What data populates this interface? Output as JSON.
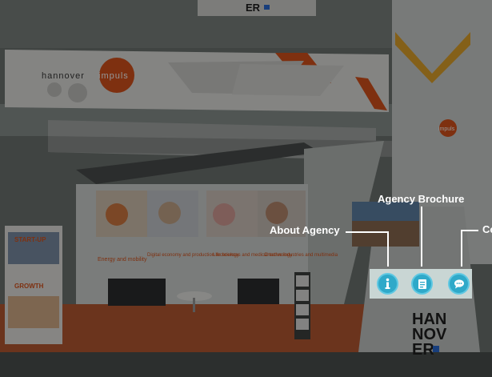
{
  "scene": {
    "top_sign": "ER",
    "banner_left_text_1": "hannover",
    "banner_left_text_2": "impuls",
    "column_text": "impuls",
    "poster_labels": [
      "Energy and mobility",
      "Digital economy and production technology",
      "Life sciences and medical technology",
      "Creative industries and multimedia"
    ],
    "rollup_text_1": "START-UP",
    "rollup_text_2": "GROWTH",
    "kiosk_logo_1": "HAN",
    "kiosk_logo_2": "NOV",
    "kiosk_logo_3": "ER"
  },
  "hotspots": {
    "about": {
      "label": "About Agency",
      "icon": "info-icon"
    },
    "brochure": {
      "label": "Agency Brochure",
      "icon": "document-icon"
    },
    "contact": {
      "label": "Co",
      "icon": "chat-icon"
    }
  },
  "colors": {
    "hotspot_fill": "#2fa9c9",
    "accent_orange": "#d9541c",
    "callout_text": "#ffffff"
  }
}
